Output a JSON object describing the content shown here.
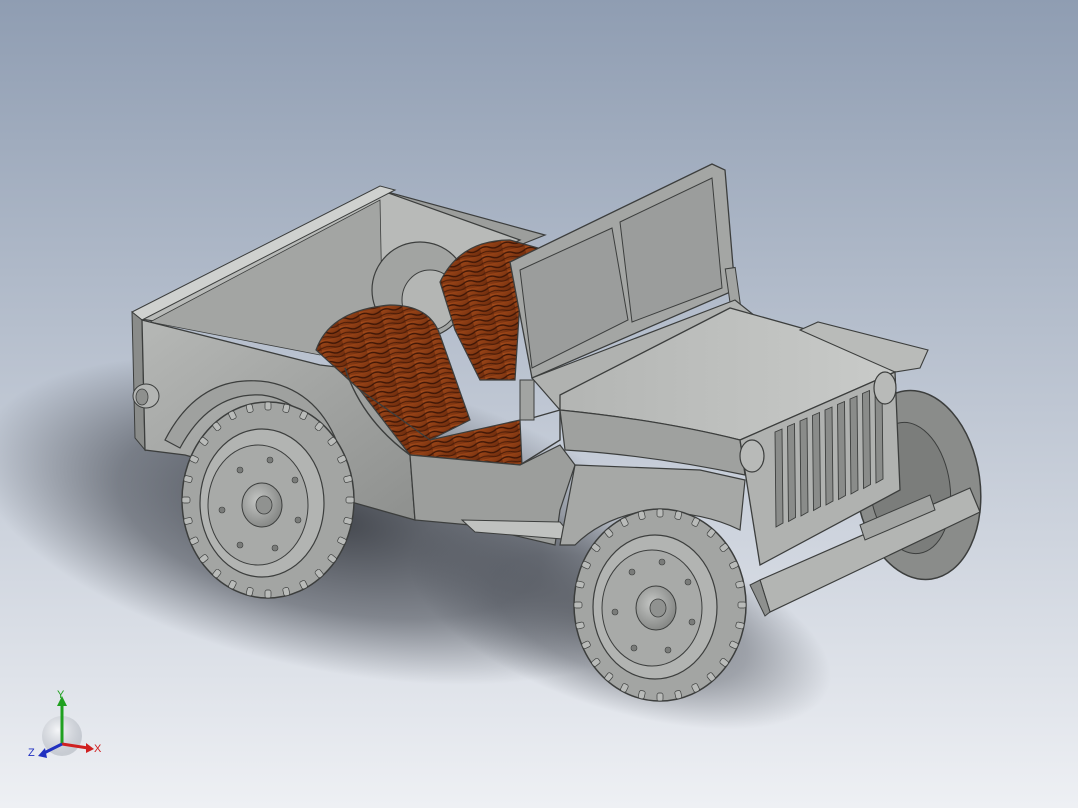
{
  "viewport": {
    "background_top": "#8f9db2",
    "background_bottom": "#eef0f4",
    "shadow_color": "#2b2e34"
  },
  "model": {
    "name": "jeep-assembly",
    "body_color": "#a9aba9",
    "body_shade": "#8e908e",
    "body_dark": "#6c6e6d",
    "body_light": "#c6c8c6",
    "tire_color": "#9d9f9d",
    "seat_color": "#8a3a12",
    "seat_grain": "#3e1606",
    "windshield_glass": "#9b9d9c"
  },
  "triad": {
    "x_label": "X",
    "y_label": "Y",
    "z_label": "Z",
    "x_color": "#d02020",
    "y_color": "#20a020",
    "z_color": "#2030c0"
  }
}
